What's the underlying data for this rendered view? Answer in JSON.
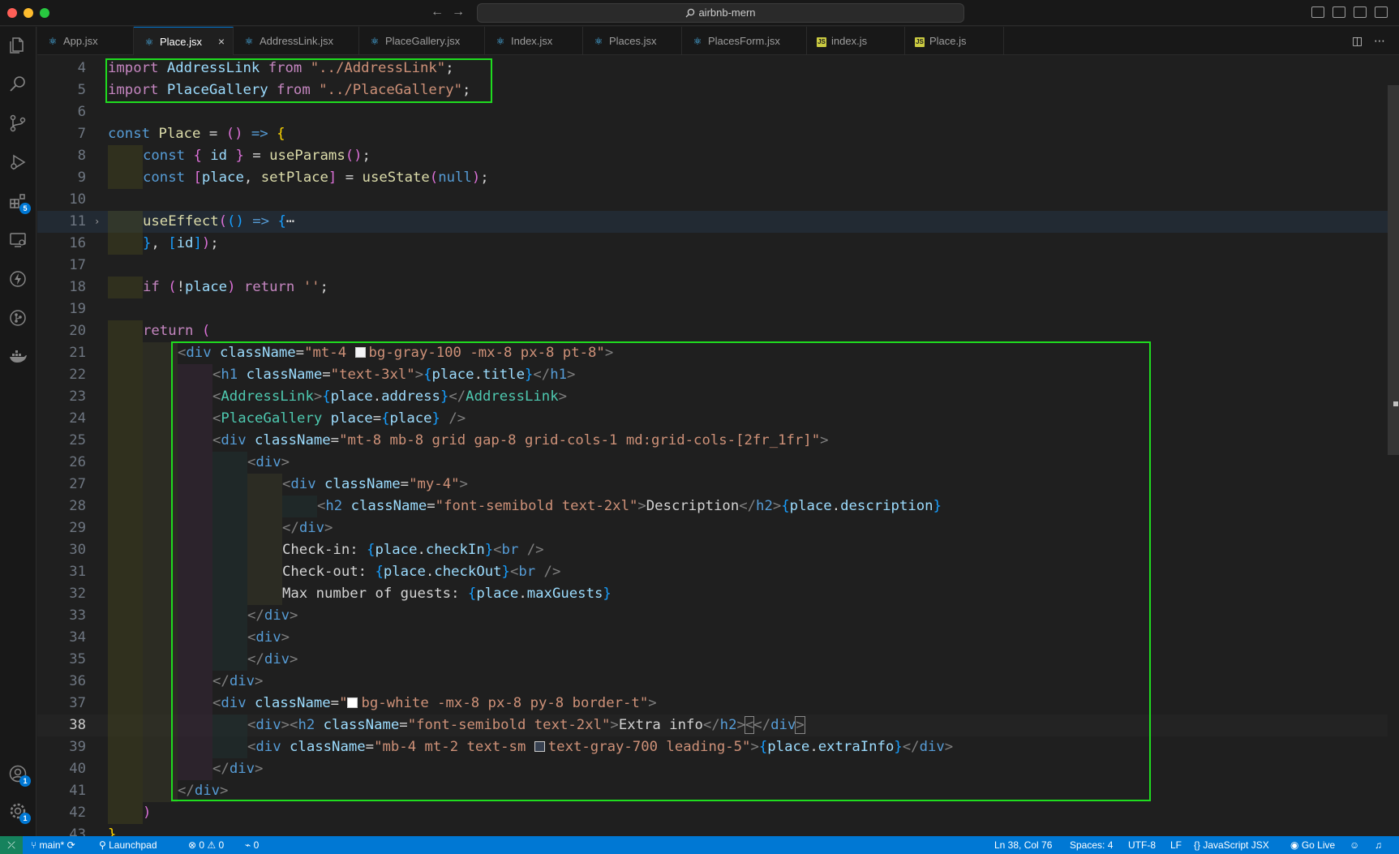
{
  "window": {
    "search_text": "airbnb-mern",
    "nav_back": "←",
    "nav_forward": "→"
  },
  "activity_bar": {
    "extensions_badge": "5",
    "accounts_badge": "1",
    "settings_badge": "1"
  },
  "tabs": [
    {
      "label": "App.jsx",
      "kind": "react"
    },
    {
      "label": "Place.jsx",
      "kind": "react",
      "active": true
    },
    {
      "label": "AddressLink.jsx",
      "kind": "react"
    },
    {
      "label": "PlaceGallery.jsx",
      "kind": "react"
    },
    {
      "label": "Index.jsx",
      "kind": "react"
    },
    {
      "label": "Places.jsx",
      "kind": "react"
    },
    {
      "label": "PlacesForm.jsx",
      "kind": "react"
    },
    {
      "label": "index.js",
      "kind": "js"
    },
    {
      "label": "Place.js",
      "kind": "js"
    }
  ],
  "tab_close": "×",
  "tab_js_icon": "JS",
  "fold_chevron": "›",
  "code": {
    "ln4": "4",
    "ln5": "5",
    "ln6": "6",
    "ln7": "7",
    "ln8": "8",
    "ln9": "9",
    "ln10": "10",
    "ln11": "11",
    "ln16": "16",
    "ln17": "17",
    "ln18": "18",
    "ln19": "19",
    "ln20": "20",
    "ln21": "21",
    "ln22": "22",
    "ln23": "23",
    "ln24": "24",
    "ln25": "25",
    "ln26": "26",
    "ln27": "27",
    "ln28": "28",
    "ln29": "29",
    "ln30": "30",
    "ln31": "31",
    "ln32": "32",
    "ln33": "33",
    "ln34": "34",
    "ln35": "35",
    "ln36": "36",
    "ln37": "37",
    "ln38": "38",
    "ln39": "39",
    "ln40": "40",
    "ln41": "41",
    "ln42": "42",
    "ln43": "43",
    "import_kw": "import",
    "from_kw": "from",
    "address_link": "AddressLink",
    "address_link_path": "\"../AddressLink\"",
    "place_gallery": "PlaceGallery",
    "place_gallery_path": "\"../PlaceGallery\"",
    "semicolon": ";",
    "const_kw": "const",
    "place_component": "Place",
    "equals": " = ",
    "paren_open": "(",
    "paren_close": ")",
    "arrow": " => ",
    "brace_open": "{",
    "brace_close": "}",
    "id_var": " id ",
    "use_params": "useParams",
    "bracket_open": "[",
    "bracket_close": "]",
    "place_var": "place",
    "comma": ", ",
    "set_place": "setPlace",
    "use_state": "useState",
    "null_kw": "null",
    "use_effect": "useEffect",
    "ellipsis": "⋯",
    "id_short": "id",
    "if_kw": "if",
    "not_op": "!",
    "return_kw": "return",
    "empty_str": "''",
    "lt": "<",
    "gt": ">",
    "lt_slash": "</",
    "self_close": " />",
    "div_tag": "div",
    "h1_tag": "h1",
    "h2_tag": "h2",
    "br_tag": "br",
    "class_name_attr": "className",
    "eq": "=",
    "place_attr": "place",
    "dot": ".",
    "title_prop": "title",
    "address_prop": "address",
    "description_prop": "description",
    "check_in_prop": "checkIn",
    "check_out_prop": "checkOut",
    "max_guests_prop": "maxGuests",
    "extra_info_prop": "extraInfo",
    "cls_line21_a": "\"mt-4 ",
    "cls_line21_b": "bg-gray-100 -mx-8 px-8 pt-8\"",
    "cls_line22": "\"text-3xl\"",
    "cls_line25": "\"mt-8 mb-8 grid gap-8 grid-cols-1 md:grid-cols-[2fr_1fr]\"",
    "cls_line27": "\"my-4\"",
    "cls_h2": "\"font-semibold text-2xl\"",
    "text_description": "Description",
    "text_check_in": "Check-in: ",
    "text_check_out": "Check-out: ",
    "text_max_guests": "Max number of guests: ",
    "cls_line37_a": "\"",
    "cls_line37_b": "bg-white -mx-8 px-8 py-8 border-t\"",
    "text_extra_info": "Extra info",
    "cls_line39_a": "\"mb-4 mt-2 text-sm ",
    "cls_line39_b": "text-gray-700 leading-5\""
  },
  "swatch_colors": {
    "gray100": "#f3f4f6",
    "white": "#ffffff",
    "gray700": "#374151"
  },
  "status_bar": {
    "branch": "main*",
    "launchpad": "Launchpad",
    "errors": "0",
    "warnings": "0",
    "ports": "0",
    "position": "Ln 38, Col 76",
    "spaces": "Spaces: 4",
    "encoding": "UTF-8",
    "eol": "LF",
    "language": "JavaScript JSX",
    "go_live": "Go Live"
  },
  "colors": {
    "accent": "#0078d4",
    "annotation_box": "#1fdc1f"
  }
}
